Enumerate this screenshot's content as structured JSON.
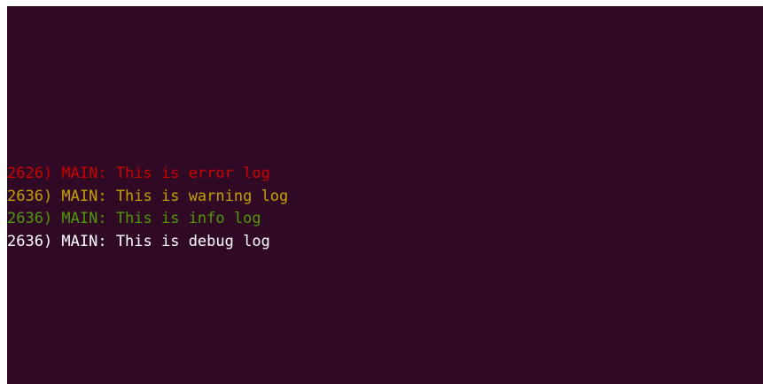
{
  "terminal": {
    "background": "#300a24",
    "lines": [
      {
        "text": "2626) MAIN: This is error log",
        "level": "error",
        "color": "#cc0000"
      },
      {
        "text": "2636) MAIN: This is warning log",
        "level": "warning",
        "color": "#c4a000"
      },
      {
        "text": "2636) MAIN: This is info log",
        "level": "info",
        "color": "#4e9a06"
      },
      {
        "text": "2636) MAIN: This is debug log",
        "level": "debug",
        "color": "#ffffff"
      }
    ]
  }
}
